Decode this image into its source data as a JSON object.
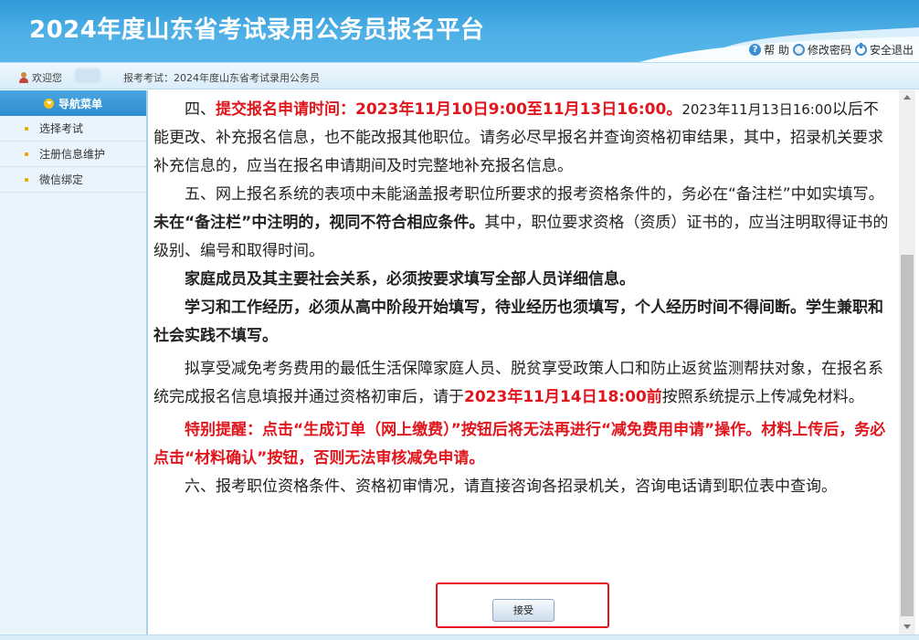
{
  "header": {
    "title": "2024年度山东省考试录用公务员报名平台",
    "links": {
      "help": "帮 助",
      "change_password": "修改密码",
      "logout": "安全退出"
    }
  },
  "infobar": {
    "welcome": "欢迎您",
    "exam_label": "报考考试：2024年度山东省考试录用公务员"
  },
  "sidebar": {
    "header": "导航菜单",
    "items": [
      {
        "label": "选择考试"
      },
      {
        "label": "注册信息维护"
      },
      {
        "label": "微信绑定"
      }
    ]
  },
  "content": {
    "p4_prefix": "四、",
    "p4_red": "提交报名申请时间：2023年11月10日9:00至11月13日16:00。",
    "p4_small": "2023年11月13日16:00",
    "p4_rest": "以后不能更改、补充报名信息，也不能改报其他职位。请务必尽早报名并查询资格初审结果，其中，招录机关要求补充信息的，应当在报名申请期间及时完整地补充报名信息。",
    "p5_a": "五、网上报名系统的表项中未能涵盖报考职位所要求的报考资格条件的，务必在“备注栏”中如实填写。",
    "p5_b": "未在“备注栏”中注明的，视同不符合相应条件。",
    "p5_c": "其中，职位要求资格（资质）证书的，应当注明取得证书的级别、编号和取得时间。",
    "family": "家庭成员及其主要社会关系，必须按要求填写全部人员详细信息。",
    "experience": "学习和工作经历，必须从高中阶段开始填写，待业经历也须填写，个人经历时间不得间断。学生兼职和社会实践不填写。",
    "reduction_a": "拟享受减免考务费用的最低生活保障家庭人员、脱贫享受政策人口和防止返贫监测帮扶对象，在报名系统完成报名信息填报并通过资格初审后，请于",
    "reduction_red": "2023年11月14日18:00前",
    "reduction_b": "按照系统提示上传减免材料。",
    "reminder": "特别提醒：点击“生成订单（网上缴费）”按钮后将无法再进行“减免费用申请”操作。材料上传后，务必点击“材料确认”按钮，否则无法审核减免申请。",
    "p6": "六、报考职位资格条件、资格初审情况，请直接咨询各招录机关，咨询电话请到职位表中查询。",
    "accept_label": "接受"
  },
  "colors": {
    "header_blue": "#4fb0e6",
    "highlight_red": "#e0161c",
    "accent_yellow": "#f5c21a"
  },
  "icons": [
    "help-icon",
    "key-icon",
    "power-icon",
    "user-icon",
    "nav-menu-icon"
  ]
}
